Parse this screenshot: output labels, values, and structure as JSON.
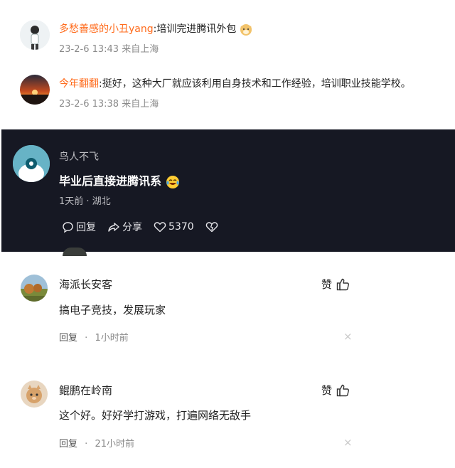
{
  "comments": [
    {
      "name": "多愁善感的小丑yang",
      "separator": ":",
      "text": "培训完进腾讯外包",
      "meta": "23-2-6 13:43 来自上海",
      "emoji": "doge-emoji"
    },
    {
      "name": "今年翻翻",
      "separator": ":",
      "text": "挺好，这种大厂就应该利用自身技术和工作经验，培训职业技能学校。",
      "meta": "23-2-6 13:38 来自上海"
    }
  ],
  "featured": {
    "name": "鸟人不飞",
    "text": "毕业后直接进腾讯系",
    "emoji": "laughing-crying-emoji",
    "meta": "1天前 · 湖北",
    "actions": {
      "reply": "回复",
      "share": "分享",
      "likes": "5370"
    }
  },
  "replies": [
    {
      "name": "海派长安客",
      "text": "搞电子竞技，发展玩家",
      "like_label": "赞",
      "reply_label": "回复",
      "dot": "·",
      "time": "1小时前",
      "close": "×"
    },
    {
      "name": "鲲鹏在岭南",
      "text": "这个好。好好学打游戏，打遍网络无敌手",
      "like_label": "赞",
      "reply_label": "回复",
      "dot": "·",
      "time": "21小时前",
      "close": "×"
    }
  ],
  "colors": {
    "username": "#ff6a1a",
    "dark_bg": "#161823",
    "meta": "#8a8a8a"
  }
}
